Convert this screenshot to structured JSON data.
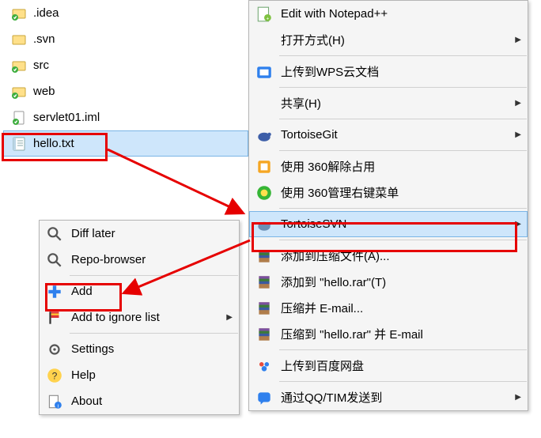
{
  "files": [
    {
      "name": ".idea",
      "icon": "folder-green"
    },
    {
      "name": ".svn",
      "icon": "folder-yellow"
    },
    {
      "name": "src",
      "icon": "folder-green"
    },
    {
      "name": "web",
      "icon": "folder-green"
    },
    {
      "name": "servlet01.iml",
      "icon": "file-green"
    },
    {
      "name": "hello.txt",
      "icon": "file-txt"
    }
  ],
  "selected_file_index": 5,
  "right_menu": {
    "items": [
      {
        "label": "Edit with Notepad++",
        "icon": "notepad",
        "arrow": false
      },
      {
        "label": "打开方式(H)",
        "icon": "",
        "arrow": true
      },
      {
        "sep": true
      },
      {
        "label": "上传到WPS云文档",
        "icon": "wps",
        "arrow": false
      },
      {
        "sep": true
      },
      {
        "label": "共享(H)",
        "icon": "",
        "arrow": true
      },
      {
        "sep": true
      },
      {
        "label": "TortoiseGit",
        "icon": "turtle",
        "arrow": true
      },
      {
        "sep": true
      },
      {
        "label": "使用 360解除占用",
        "icon": "box360",
        "arrow": false
      },
      {
        "label": "使用 360管理右键菜单",
        "icon": "ball360",
        "arrow": false
      },
      {
        "sep": true
      },
      {
        "label": "TortoiseSVN",
        "icon": "svn",
        "arrow": true,
        "highlight": true
      },
      {
        "sep": true
      },
      {
        "label": "添加到压缩文件(A)...",
        "icon": "rar",
        "arrow": false
      },
      {
        "label": "添加到 \"hello.rar\"(T)",
        "icon": "rar",
        "arrow": false
      },
      {
        "label": "压缩并 E-mail...",
        "icon": "rar",
        "arrow": false
      },
      {
        "label": "压缩到 \"hello.rar\" 并 E-mail",
        "icon": "rar",
        "arrow": false
      },
      {
        "sep": true
      },
      {
        "label": "上传到百度网盘",
        "icon": "baidu",
        "arrow": false
      },
      {
        "sep": true
      },
      {
        "label": "通过QQ/TIM发送到",
        "icon": "qq",
        "arrow": true
      }
    ],
    "highlight_index": 12
  },
  "sub_menu": {
    "items": [
      {
        "label": "Diff later",
        "icon": "magnifier",
        "arrow": false
      },
      {
        "label": "Repo-browser",
        "icon": "magnifier",
        "arrow": false
      },
      {
        "sep": true
      },
      {
        "label": "Add",
        "icon": "plus",
        "arrow": false,
        "red_box": true
      },
      {
        "label": "Add to ignore list",
        "icon": "flag",
        "arrow": true
      },
      {
        "sep": true
      },
      {
        "label": "Settings",
        "icon": "gear",
        "arrow": false
      },
      {
        "label": "Help",
        "icon": "help",
        "arrow": false
      },
      {
        "label": "About",
        "icon": "about",
        "arrow": false
      }
    ]
  },
  "arrows_color": "#e60000"
}
